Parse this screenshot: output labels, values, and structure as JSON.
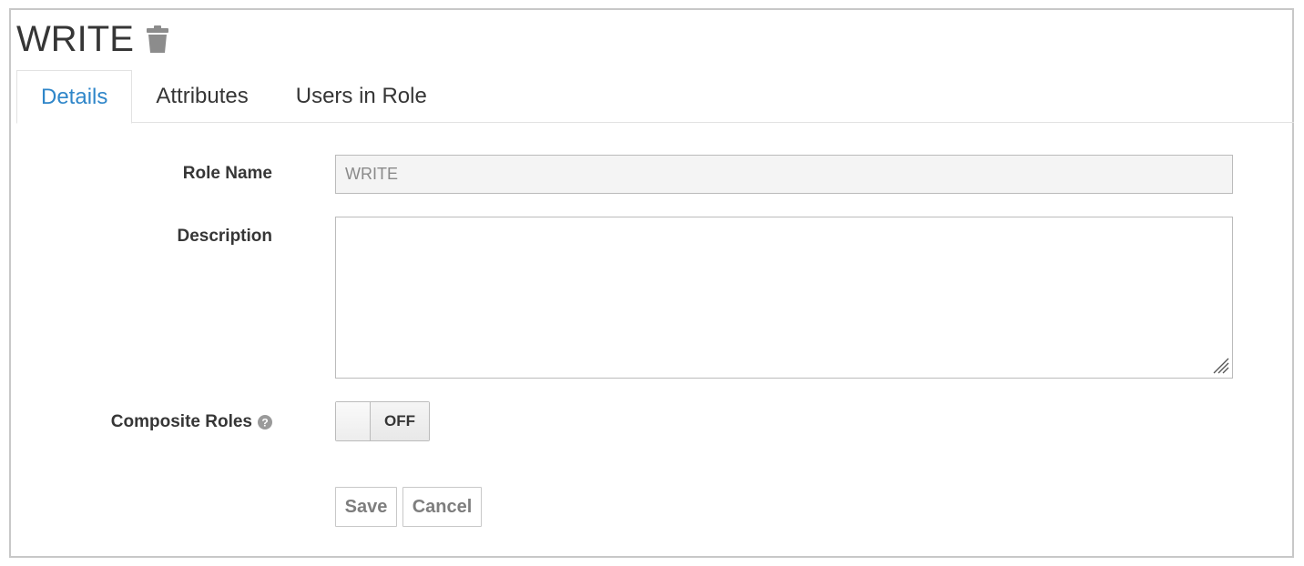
{
  "header": {
    "title": "WRITE",
    "delete_icon": "trash-icon"
  },
  "tabs": [
    {
      "label": "Details",
      "active": true
    },
    {
      "label": "Attributes",
      "active": false
    },
    {
      "label": "Users in Role",
      "active": false
    }
  ],
  "form": {
    "role_name": {
      "label": "Role Name",
      "value": "WRITE"
    },
    "description": {
      "label": "Description",
      "value": ""
    },
    "composite_roles": {
      "label": "Composite Roles",
      "help_icon": "question-circle-icon",
      "state": "OFF"
    }
  },
  "actions": {
    "save_label": "Save",
    "cancel_label": "Cancel"
  },
  "colors": {
    "active_tab": "#2f86c9",
    "text": "#363636",
    "disabled_button_text": "#7e7e7e",
    "readonly_field_bg": "#f4f4f4"
  }
}
